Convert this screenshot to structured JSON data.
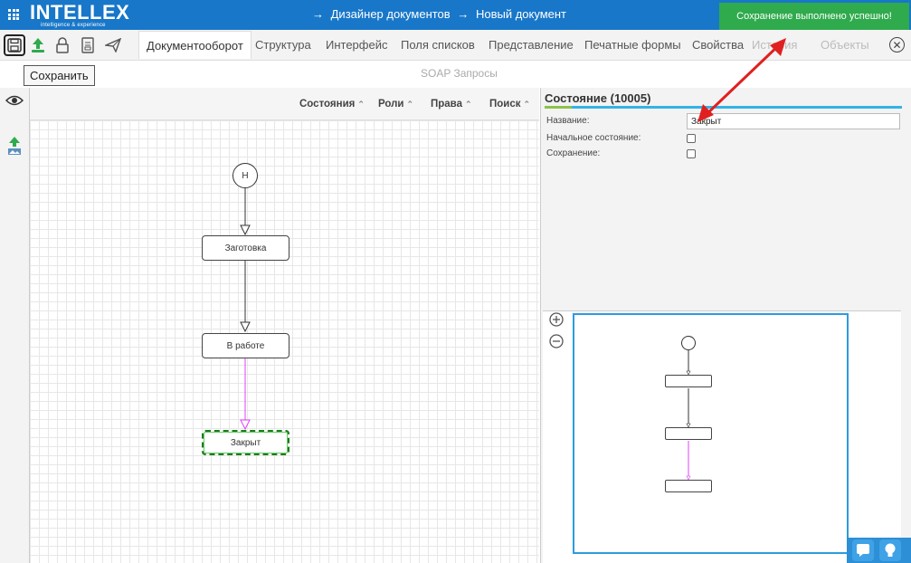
{
  "app": {
    "logo_text": "INTELLEX",
    "logo_tagline": "intelligence & experience",
    "breadcrumb": [
      "→",
      "Дизайнер документов",
      "→",
      "Новый документ"
    ]
  },
  "toast": {
    "text": "Сохранение выполнено успешно!",
    "color": "#2faa4d"
  },
  "toolbar": {
    "icons": [
      "save-icon",
      "upload-icon",
      "lock-icon",
      "document-icon",
      "send-icon"
    ],
    "tooltip": "Сохранить",
    "tabs": [
      {
        "label": "Документооборот",
        "active": true
      },
      {
        "label": "Структура"
      },
      {
        "label": "Интерфейс"
      },
      {
        "label": "Поля списков"
      },
      {
        "label": "Представление"
      },
      {
        "label": "Печатные формы"
      },
      {
        "label": "Свойства"
      },
      {
        "label": "История",
        "disabled": true
      },
      {
        "label": "Объекты",
        "disabled": true
      }
    ],
    "second_row_tab": "SOAP Запросы",
    "close_icon": "close-circle-icon"
  },
  "canvas_header": {
    "items": [
      "Состояния",
      "Роли",
      "Права",
      "Поиск"
    ]
  },
  "diagram": {
    "start_label": "Н",
    "nodes": [
      "Заготовка",
      "В работе",
      "Закрыт"
    ],
    "selected_node": "Закрыт",
    "highlight_color": "#e040fb"
  },
  "properties": {
    "title": "Состояние (10005)",
    "name_label": "Название:",
    "name_value": "Закрыт",
    "initial_label": "Начальное состояние:",
    "initial_checked": false,
    "save_label": "Сохранение:",
    "save_checked": false
  },
  "colors": {
    "topbar": "#1877c9",
    "accent": "#33b3e6",
    "annotation": "#e02020"
  }
}
